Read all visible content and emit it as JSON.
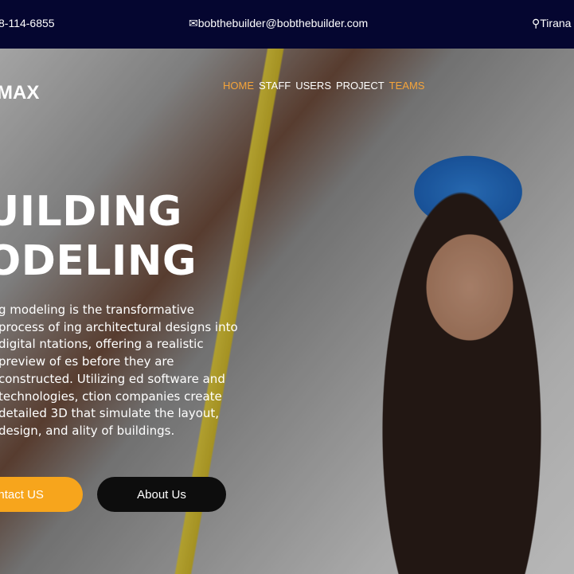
{
  "topbar": {
    "phone": "8-114-6855",
    "email": "bobthebuilder@bobthebuilder.com",
    "location": "Tirana"
  },
  "brand": {
    "logo": "MAX"
  },
  "nav": {
    "items": [
      {
        "label": "HOME",
        "active": true
      },
      {
        "label": "STAFF"
      },
      {
        "label": "USERS"
      },
      {
        "label": "PROJECT"
      },
      {
        "label": "TEAMS",
        "active": true
      }
    ]
  },
  "hero": {
    "title_line1": "UILDING",
    "title_line2": "ODELING",
    "description": "g modeling is the transformative process of ing architectural designs into digital ntations, offering a realistic preview of es before they are constructed. Utilizing ed software and technologies, ction companies create detailed 3D that simulate the layout, design, and ality of buildings.",
    "contact_button": "ontact US",
    "about_button": "About Us"
  },
  "colors": {
    "topbar": "#050630",
    "accent": "#f5a43a",
    "button_primary": "#f7a51c",
    "button_dark": "#0d0d0d"
  }
}
